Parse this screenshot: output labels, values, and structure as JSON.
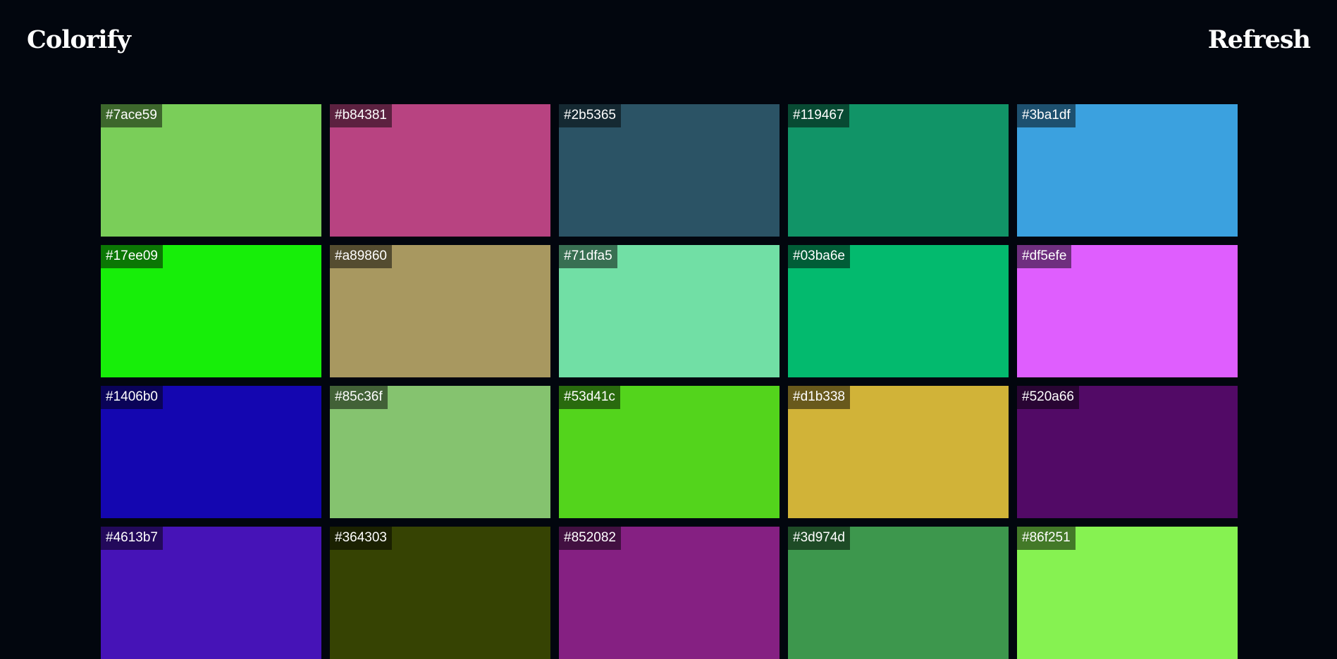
{
  "header": {
    "logo": "Colorify",
    "refresh_label": "Refresh"
  },
  "swatches": [
    {
      "hex": "#7ace59"
    },
    {
      "hex": "#b84381"
    },
    {
      "hex": "#2b5365"
    },
    {
      "hex": "#119467"
    },
    {
      "hex": "#3ba1df"
    },
    {
      "hex": "#17ee09"
    },
    {
      "hex": "#a89860"
    },
    {
      "hex": "#71dfa5"
    },
    {
      "hex": "#03ba6e"
    },
    {
      "hex": "#df5efe"
    },
    {
      "hex": "#1406b0"
    },
    {
      "hex": "#85c36f"
    },
    {
      "hex": "#53d41c"
    },
    {
      "hex": "#d1b338"
    },
    {
      "hex": "#520a66"
    },
    {
      "hex": "#4613b7"
    },
    {
      "hex": "#364303"
    },
    {
      "hex": "#852082"
    },
    {
      "hex": "#3d974d"
    },
    {
      "hex": "#86f251"
    }
  ]
}
